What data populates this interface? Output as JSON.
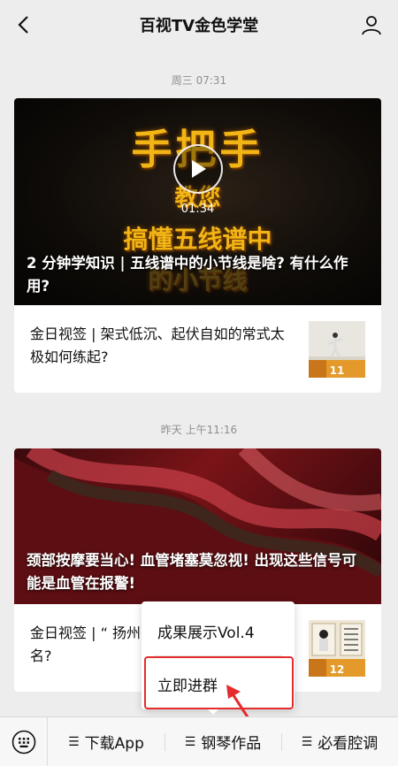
{
  "header": {
    "title": "百视TV金色学堂",
    "back_icon": "chevron-left-icon",
    "profile_icon": "person-icon"
  },
  "messages": [
    {
      "timestamp": "周三 07:31",
      "hero": {
        "overlay_line1": "手把手",
        "overlay_line2": "教您",
        "overlay_line3": "搞懂五线谱中",
        "overlay_line4": "的小节线",
        "duration": "01:34",
        "caption": "2 分钟学知识 | 五线谱中的小节线是啥? 有什么作用?"
      },
      "sub": {
        "title": "金日视签 | 架式低沉、起伏自如的常式太极如何练起?",
        "thumb_number": "11"
      }
    },
    {
      "timestamp": "昨天 上午11:16",
      "hero": {
        "caption": "颈部按摩要当心! 血管堵塞莫忽视! 出现这些信号可能是血管在报警!"
      },
      "sub": {
        "title_left": "金日视签 | “ 扬州",
        "title_line2": "名?",
        "thumb_number": "12"
      }
    }
  ],
  "popup": {
    "items": [
      "成果展示Vol.4",
      "立即进群"
    ]
  },
  "bottom_menu": {
    "keyboard_icon": "keyboard-icon",
    "items": [
      "下载App",
      "钢琴作品",
      "必看腔调"
    ]
  },
  "colors": {
    "highlight_box": "#e52b2b",
    "background": "#ededed"
  }
}
